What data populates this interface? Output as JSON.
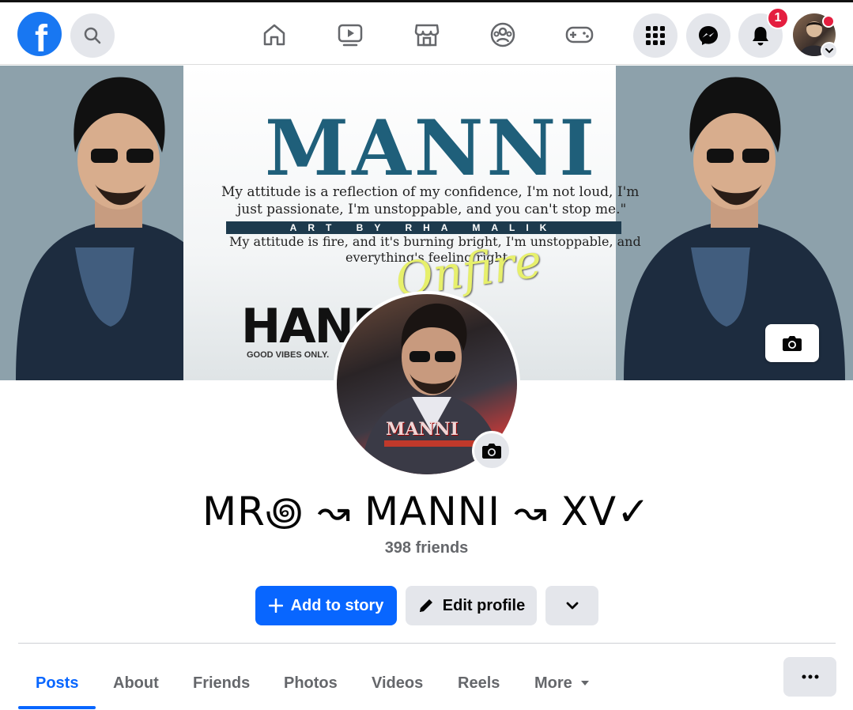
{
  "topbar": {
    "logo_icon": "facebook-logo",
    "search_icon": "search-icon",
    "nav": [
      "home-icon",
      "video-icon",
      "marketplace-icon",
      "groups-icon",
      "gaming-icon"
    ],
    "menu_icon": "grid-menu-icon",
    "messenger_icon": "messenger-icon",
    "notifications_icon": "bell-icon",
    "notification_count": "1"
  },
  "cover": {
    "title": "MANNI",
    "quote_line1": "My attitude is a reflection of my confidence, I'm not loud, I'm",
    "quote_line2": "just passionate, I'm unstoppable, and you can't stop me.\"",
    "band": "ART BY RHA MALIK",
    "quote_line3": "My attitude is fire, and it's burning bright, I'm unstoppable, and",
    "quote_line4": "everything's feeling right",
    "script": "Onfire",
    "hand_text": "HANDS",
    "hand_sub": "GOOD VIBES ONLY.",
    "camera_icon": "camera-icon"
  },
  "profile": {
    "pic_text": "MANNI",
    "name": "MR꩜ ↝ MANNI ↝ XV✓",
    "friends": "398 friends"
  },
  "actions": {
    "add_story": "Add to story",
    "edit_profile": "Edit profile"
  },
  "tabs": [
    "Posts",
    "About",
    "Friends",
    "Photos",
    "Videos",
    "Reels",
    "More"
  ],
  "colors": {
    "brand": "#0866ff",
    "notification": "#e41e3f",
    "secondary_btn": "#e4e6eb",
    "muted_text": "#65676b"
  }
}
